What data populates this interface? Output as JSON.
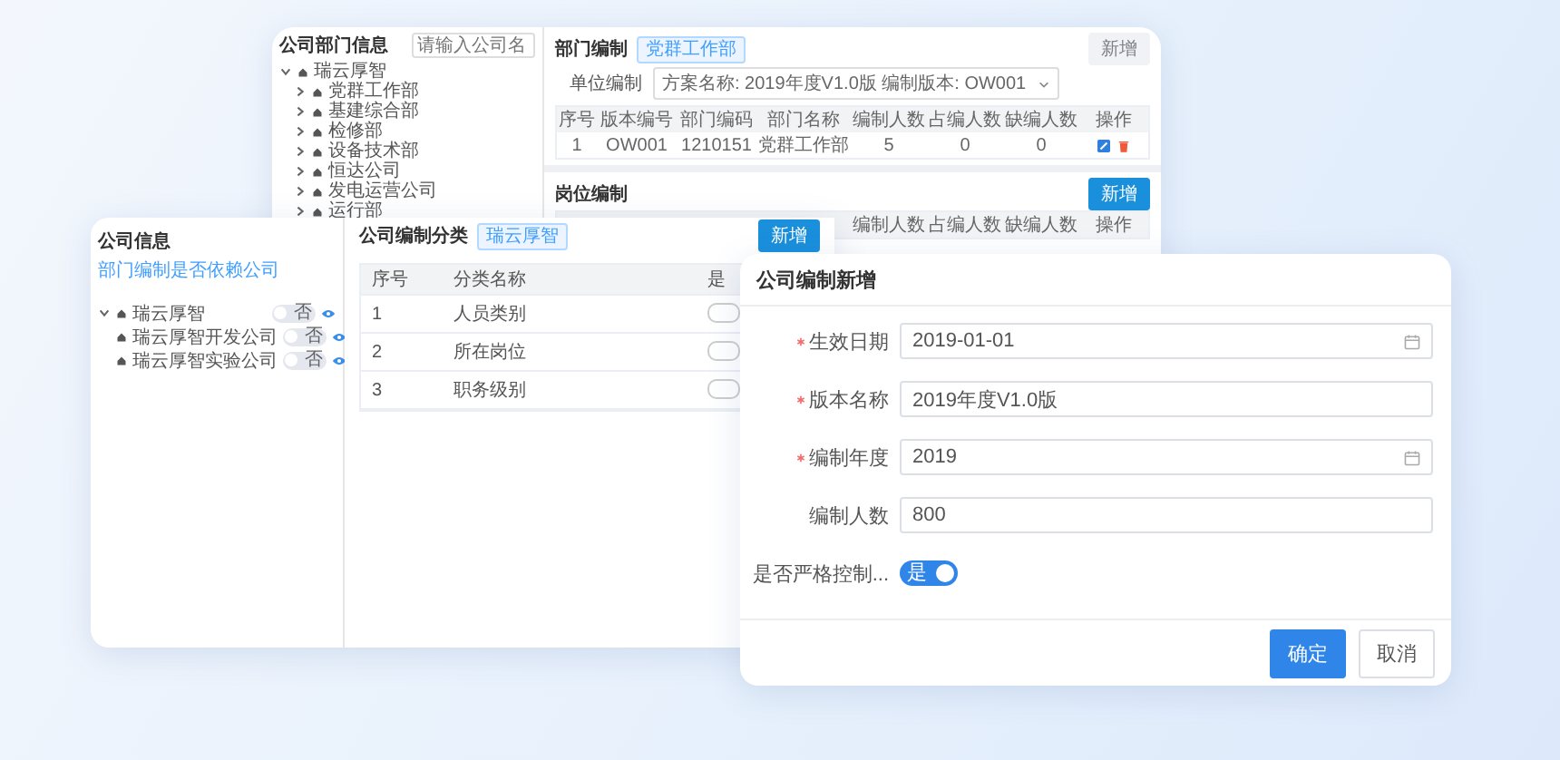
{
  "dept_window": {
    "sidebar": {
      "title": "公司部门信息",
      "search": {
        "placeholder": "请输入公司名"
      },
      "tree": [
        {
          "label": "瑞云厚智",
          "expanded": true,
          "children": [
            {
              "label": "党群工作部",
              "expanded": false
            },
            {
              "label": "基建综合部",
              "expanded": false
            },
            {
              "label": "检修部",
              "expanded": false
            },
            {
              "label": "设备技术部",
              "expanded": false
            },
            {
              "label": "恒达公司",
              "expanded": false
            },
            {
              "label": "发电运营公司",
              "expanded": false
            },
            {
              "label": "运行部",
              "expanded": false
            }
          ]
        }
      ]
    },
    "dept_section": {
      "title": "部门编制",
      "tag": "党群工作部",
      "add_button": {
        "label": "新增",
        "disabled": true
      },
      "filter": {
        "label": "单位编制",
        "value": "方案名称: 2019年度V1.0版 编制版本: OW001"
      },
      "table": {
        "columns": [
          "序号",
          "版本编号",
          "部门编码",
          "部门名称",
          "编制人数",
          "占编人数",
          "缺编人数",
          "操作"
        ],
        "rows": [
          {
            "cells": [
              "1",
              "OW001",
              "1210151",
              "党群工作部",
              "5",
              "0",
              "0"
            ]
          }
        ]
      }
    },
    "post_section": {
      "title": "岗位编制",
      "add_button": {
        "label": "新增",
        "disabled": false
      },
      "table": {
        "columns": [
          "编制人数",
          "占编人数",
          "缺编人数",
          "操作"
        ]
      }
    }
  },
  "company_window": {
    "panel": {
      "title": "公司信息",
      "link": "部门编制是否依赖公司",
      "tree": [
        {
          "label": "瑞云厚智",
          "expanded": true,
          "switch": {
            "text": "否",
            "on": false
          },
          "children": [
            {
              "label": "瑞云厚智开发公司",
              "switch": {
                "text": "否",
                "on": false
              }
            },
            {
              "label": "瑞云厚智实验公司",
              "switch": {
                "text": "否",
                "on": false
              }
            }
          ]
        }
      ]
    },
    "category": {
      "title": "公司编制分类",
      "tag": "瑞云厚智",
      "add_button": {
        "label": "新增",
        "disabled": false
      },
      "table": {
        "columns": [
          "序号",
          "分类名称",
          "是"
        ],
        "rows": [
          {
            "cells": [
              "1",
              "人员类别"
            ],
            "on": false
          },
          {
            "cells": [
              "2",
              "所在岗位"
            ],
            "on": false
          },
          {
            "cells": [
              "3",
              "职务级别"
            ],
            "on": false
          }
        ]
      }
    }
  },
  "dialog": {
    "title": "公司编制新增",
    "fields": [
      {
        "kind": "date",
        "label": "生效日期",
        "required": true,
        "value": "2019-01-01"
      },
      {
        "kind": "text",
        "label": "版本名称",
        "required": true,
        "value": "2019年度V1.0版"
      },
      {
        "kind": "date",
        "label": "编制年度",
        "required": true,
        "value": "2019"
      },
      {
        "kind": "text",
        "label": "编制人数",
        "required": false,
        "value": "800"
      },
      {
        "kind": "switch",
        "label": "是否严格控制...",
        "required": false,
        "on": true,
        "text": "是"
      }
    ],
    "buttons": [
      {
        "label": "确定",
        "primary": true
      },
      {
        "label": "取消",
        "primary": false
      }
    ]
  }
}
